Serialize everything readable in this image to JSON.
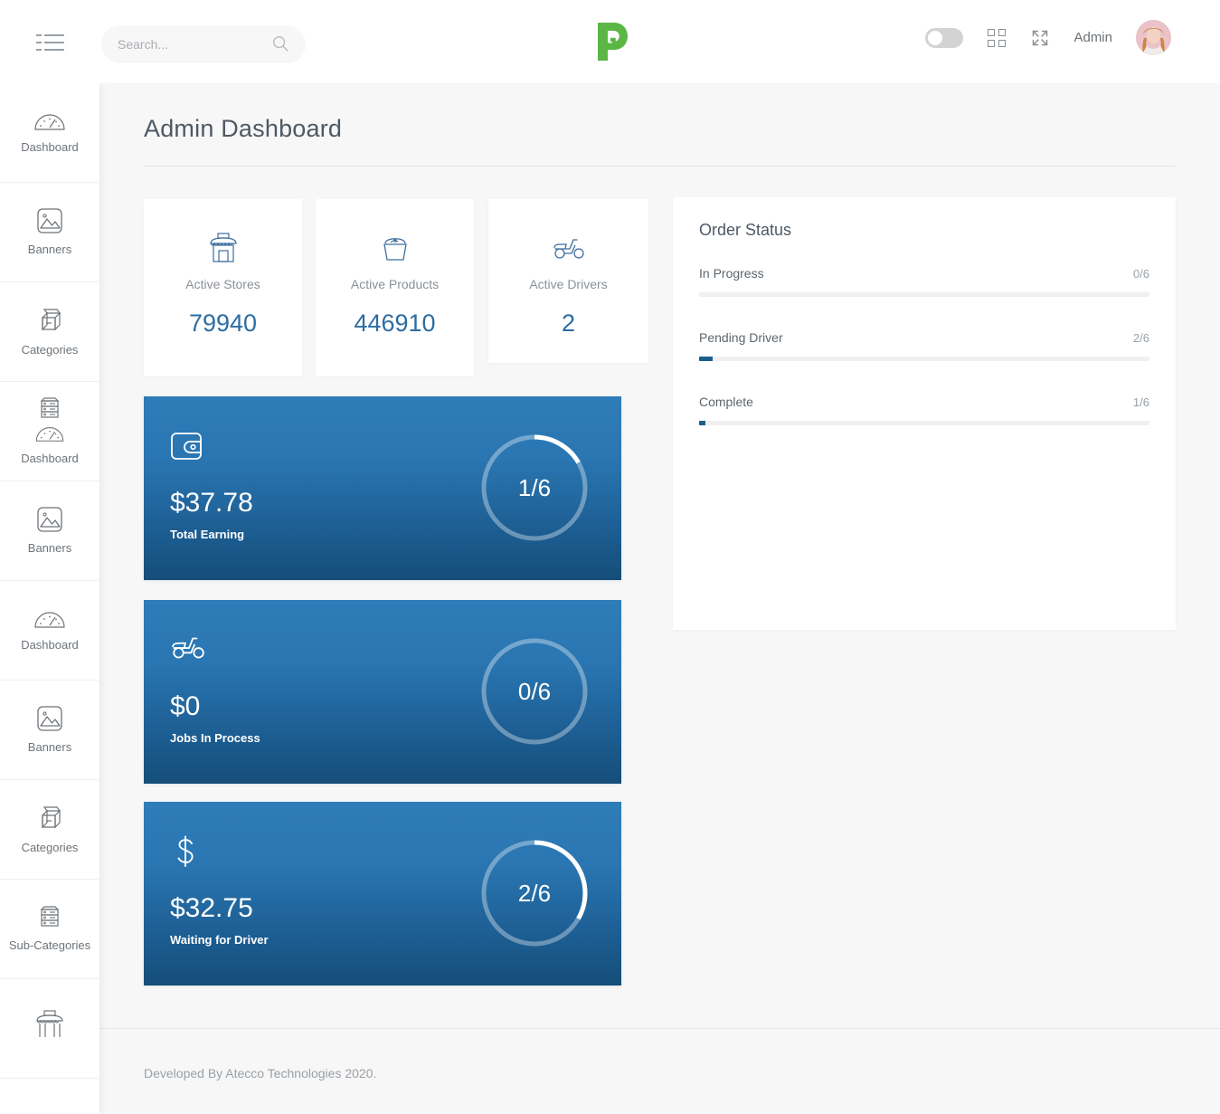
{
  "header": {
    "menu_icon": "hamburger-list-icon",
    "search": {
      "placeholder": "Search...",
      "value": "",
      "icon": "search-icon"
    },
    "logo_letter": "P",
    "logo_color": "#5cb646",
    "theme_toggle": {
      "state": "off",
      "icon": "toggle-switch"
    },
    "grid_icon": "grid-apps-icon",
    "fullscreen_icon": "fullscreen-expand-icon",
    "user_label": "Admin",
    "avatar_icon": "user-avatar"
  },
  "sidebar": {
    "items": [
      {
        "label": "Dashboard",
        "icons": [
          "gauge-icon"
        ]
      },
      {
        "label": "Banners",
        "icons": [
          "image-icon"
        ]
      },
      {
        "label": "Categories",
        "icons": [
          "boxes-icon"
        ]
      },
      {
        "label": "Dashboard",
        "icons": [
          "server-icon",
          "gauge-icon"
        ]
      },
      {
        "label": "Banners",
        "icons": [
          "image-icon"
        ]
      },
      {
        "label": "Dashboard",
        "icons": [
          "gauge-icon"
        ]
      },
      {
        "label": "Banners",
        "icons": [
          "image-icon"
        ]
      },
      {
        "label": "Categories",
        "icons": [
          "boxes-icon"
        ]
      },
      {
        "label": "Sub-Categories",
        "icons": [
          "server-icon"
        ]
      },
      {
        "label": "",
        "icons": [
          "store-icon"
        ]
      }
    ]
  },
  "main": {
    "page_title": "Admin Dashboard",
    "stats": [
      {
        "label": "Active Stores",
        "value": "79940",
        "icon": "store-icon"
      },
      {
        "label": "Active Products",
        "value": "446910",
        "icon": "basket-icon"
      },
      {
        "label": "Active Drivers",
        "value": "2",
        "icon": "scooter-icon"
      }
    ],
    "order_status": {
      "title": "Order Status",
      "rows": [
        {
          "label": "In Progress",
          "count": "0/6",
          "percent": 0
        },
        {
          "label": "Pending Driver",
          "count": "2/6",
          "percent": 3
        },
        {
          "label": "Complete",
          "count": "1/6",
          "percent": 1.5
        }
      ]
    },
    "metric_cards": [
      {
        "value": "$37.78",
        "label": "Total Earning",
        "ring": "1/6",
        "ring_fraction": 0.1667,
        "icon": "wallet-icon"
      },
      {
        "value": "$0",
        "label": "Jobs In Process",
        "ring": "0/6",
        "ring_fraction": 0,
        "icon": "scooter-icon"
      },
      {
        "value": "$32.75",
        "label": "Waiting for Driver",
        "ring": "2/6",
        "ring_fraction": 0.3333,
        "icon": "dollar-icon"
      }
    ]
  },
  "footer": {
    "text": "Developed By Atecco Technologies 2020."
  },
  "colors": {
    "accent_blue": "#2d6da3",
    "card_gradient_top": "#2e7cb8",
    "card_gradient_bottom": "#154e79",
    "progress_blue": "#1b5e8e",
    "logo_green": "#5cb646",
    "page_background": "#f7f7f7"
  }
}
